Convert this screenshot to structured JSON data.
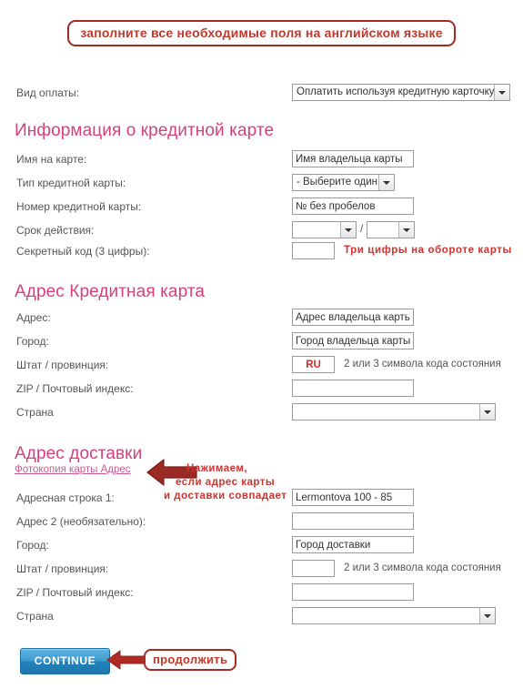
{
  "banner": {
    "text": "заполните все необходимые поля на английском языке"
  },
  "payment": {
    "label": "Вид оплаты:",
    "selected": "Оплатить используя кредитную карточку"
  },
  "card_section": {
    "heading": "Информация о кредитной карте",
    "rows": {
      "name_label": "Имя на карте:",
      "name_value": "Имя владельца карты",
      "type_label": "Тип кредитной карты:",
      "type_value": "- Выберите один -",
      "number_label": "Номер кредитной карты:",
      "number_value": "№ без пробелов",
      "expiry_label": "Срок действия:",
      "expiry_month": "",
      "expiry_sep": "/",
      "expiry_year": "",
      "cvv_label": "Секретный код (3 цифры):",
      "cvv_value": "",
      "cvv_hint": "Три цифры на обороте карты"
    }
  },
  "billing_section": {
    "heading": "Адрес Кредитная карта",
    "rows": {
      "address_label": "Адрес:",
      "address_value": "Адрес владельца карты",
      "city_label": "Город:",
      "city_value": "Город владельца карты",
      "state_label": "Штат / провинция:",
      "state_value": "RU",
      "state_hint": "2 или 3 символа кода состояния",
      "zip_label": "ZIP / Почтовый индекс:",
      "zip_value": "",
      "country_label": "Страна",
      "country_value": ""
    }
  },
  "shipping_section": {
    "heading": "Адрес доставки",
    "copy_link": "Фотокопия карты Адрес",
    "annotation": {
      "line1": "Нажимаем,",
      "line2": "если адрес карты",
      "line3": "и доставки совпадает"
    },
    "rows": {
      "address1_label": "Адресная строка 1:",
      "address1_value": "Lermontova 100 - 85",
      "address2_label": "Адрес 2 (необязательно):",
      "address2_value": "",
      "city_label": "Город:",
      "city_value": "Город доставки",
      "state_label": "Штат / провинция:",
      "state_value": "",
      "state_hint": "2 или 3 символа кода состояния",
      "zip_label": "ZIP / Почтовый индекс:",
      "zip_value": "",
      "country_label": "Страна",
      "country_value": ""
    }
  },
  "footer": {
    "continue_label": "CONTINUE",
    "continue_annotation": "продолжить"
  },
  "colors": {
    "heading": "#d6407f",
    "annotation_red": "#d2322d",
    "banner_border": "#a32b22",
    "button_blue": "#2482bb",
    "arrow_fill": "#9c2a24"
  }
}
